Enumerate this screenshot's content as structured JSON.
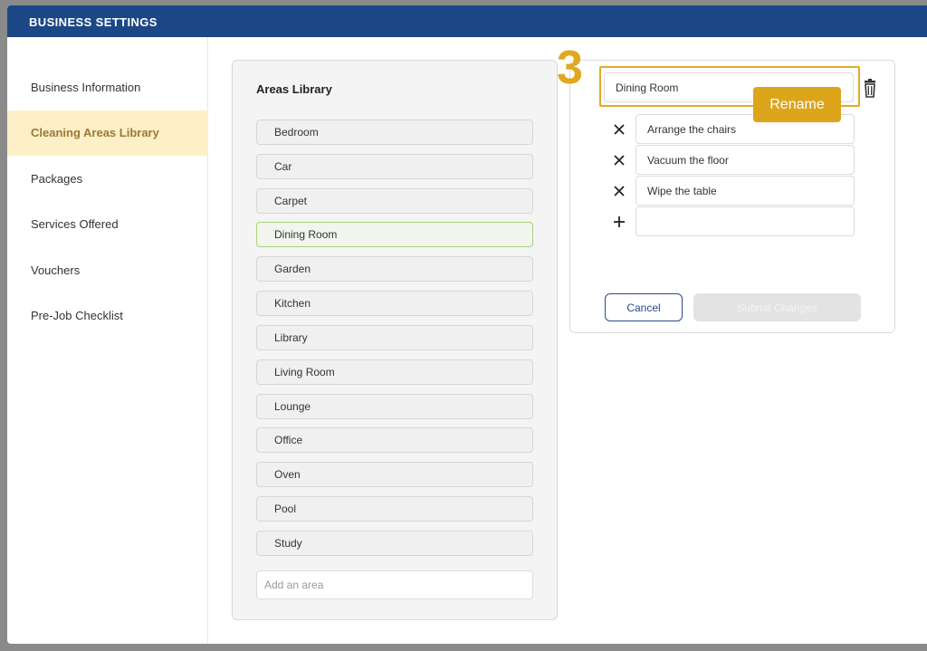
{
  "header": {
    "title": "BUSINESS SETTINGS"
  },
  "sidebar": {
    "items": [
      {
        "label": "Business Information",
        "active": false
      },
      {
        "label": "Cleaning Areas Library",
        "active": true
      },
      {
        "label": "Packages",
        "active": false
      },
      {
        "label": "Services Offered",
        "active": false
      },
      {
        "label": "Vouchers",
        "active": false
      },
      {
        "label": "Pre-Job Checklist",
        "active": false
      }
    ]
  },
  "library": {
    "title": "Areas Library",
    "areas": [
      "Bedroom",
      "Car",
      "Carpet",
      "Dining Room",
      "Garden",
      "Kitchen",
      "Library",
      "Living Room",
      "Lounge",
      "Office",
      "Oven",
      "Pool",
      "Study"
    ],
    "selected": "Dining Room",
    "add_placeholder": "Add an area"
  },
  "editor": {
    "area_name": "Dining Room",
    "tasks": [
      "Arrange the chairs",
      "Vacuum the floor",
      "Wipe the table"
    ],
    "new_task_value": "",
    "cancel_label": "Cancel",
    "submit_label": "Submit Changes",
    "icons": {
      "delete": "trash-icon",
      "remove": "close-icon",
      "add": "plus-icon"
    }
  },
  "annotation": {
    "step": "3",
    "label": "Rename",
    "color": "#dca51b"
  },
  "colors": {
    "header": "#1c4786",
    "active_bg": "#fdefc8",
    "active_text": "#9a7a34",
    "selected_border": "#a9d37d"
  }
}
